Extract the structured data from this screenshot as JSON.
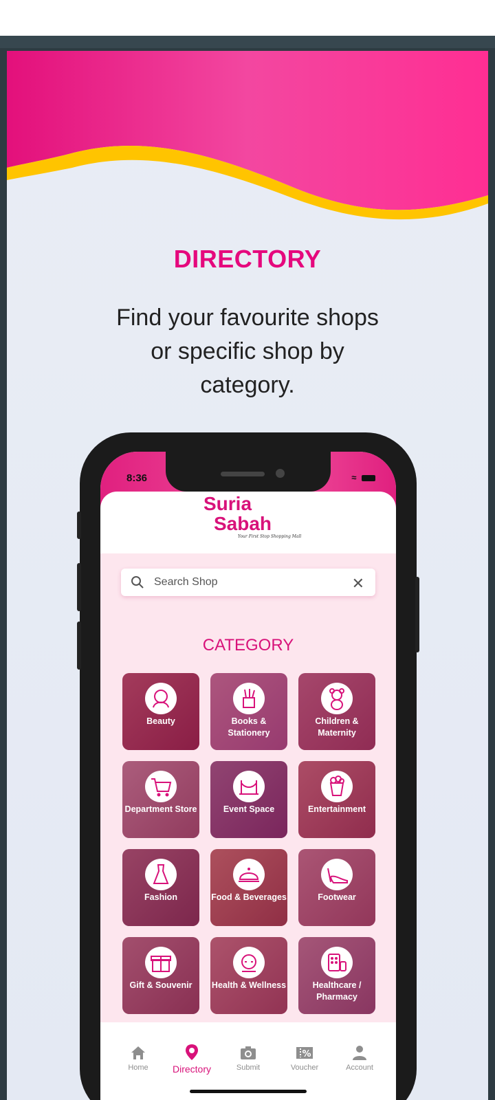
{
  "promo": {
    "headline": "DIRECTORY",
    "subtitle": "Find your favourite shops or specific shop by category."
  },
  "phone": {
    "time": "8:36",
    "logo_line1": "Suria",
    "logo_line2": "Sabah",
    "logo_tagline": "Your First Stop Shopping Mall",
    "search": {
      "placeholder": "Search Shop"
    },
    "category_title": "CATEGORY",
    "categories": [
      {
        "label": "Beauty",
        "icon": "woman-face-icon"
      },
      {
        "label": "Books & Stationery",
        "icon": "pencil-cup-icon"
      },
      {
        "label": "Children & Maternity",
        "icon": "teddy-bear-icon"
      },
      {
        "label": "Department Store",
        "icon": "shopping-cart-icon"
      },
      {
        "label": "Event Space",
        "icon": "stage-rope-icon"
      },
      {
        "label": "Entertainment",
        "icon": "popcorn-icon"
      },
      {
        "label": "Fashion",
        "icon": "dress-icon"
      },
      {
        "label": "Food & Beverages",
        "icon": "cloche-icon"
      },
      {
        "label": "Footwear",
        "icon": "high-heel-icon"
      },
      {
        "label": "Gift & Souvenir",
        "icon": "gift-icon"
      },
      {
        "label": "Health & Wellness",
        "icon": "spa-face-icon"
      },
      {
        "label": "Healthcare / Pharmacy",
        "icon": "pills-icon"
      }
    ],
    "nav": [
      {
        "label": "Home",
        "icon": "home-icon"
      },
      {
        "label": "Directory",
        "icon": "location-pin-icon",
        "active": true
      },
      {
        "label": "Submit",
        "icon": "camera-icon"
      },
      {
        "label": "Voucher",
        "icon": "voucher-icon"
      },
      {
        "label": "Account",
        "icon": "user-icon"
      }
    ]
  },
  "colors": {
    "brand": "#d8127a",
    "accent_yellow": "#ffc400",
    "headline": "#e5087d"
  }
}
